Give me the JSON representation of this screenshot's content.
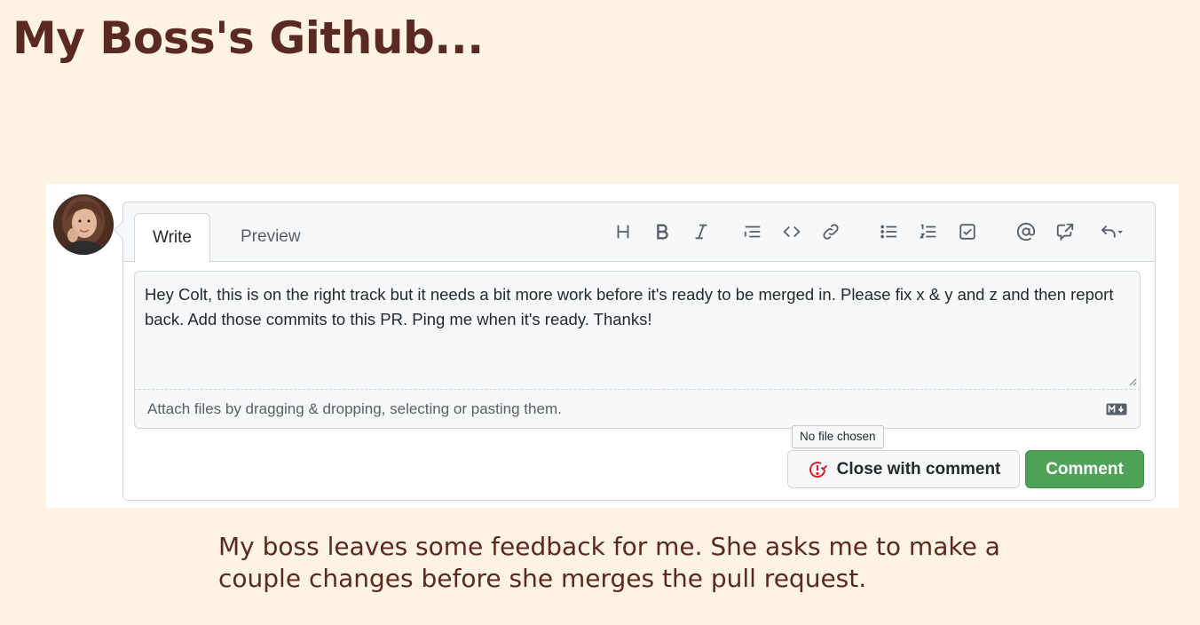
{
  "slide": {
    "title": "My Boss's Github...",
    "caption": "My boss leaves some feedback for me.  She asks me to make a couple changes before she merges the pull request."
  },
  "editor": {
    "tabs": [
      {
        "label": "Write",
        "active": true
      },
      {
        "label": "Preview",
        "active": false
      }
    ],
    "toolbar_icons": [
      "heading-icon",
      "bold-icon",
      "italic-icon",
      "quote-icon",
      "code-icon",
      "link-icon",
      "unordered-list-icon",
      "ordered-list-icon",
      "task-list-icon",
      "mention-icon",
      "cross-reference-icon",
      "reply-icon"
    ],
    "comment_text": "Hey Colt, this is on the right track but it needs a bit more work before it's ready to be merged in.  Please fix x & y and z and then report back.  Add those commits to this PR.  Ping me when it's ready.  Thanks!",
    "attach_text": "Attach files by dragging & dropping, selecting or pasting them.",
    "file_tooltip": "No file chosen"
  },
  "buttons": {
    "close_with_comment": "Close with comment",
    "comment": "Comment"
  },
  "colors": {
    "slide_background": "#fdf3e3",
    "title_color": "#5a2a22",
    "comment_button": "#4ea359",
    "close_icon": "#cf222e"
  }
}
